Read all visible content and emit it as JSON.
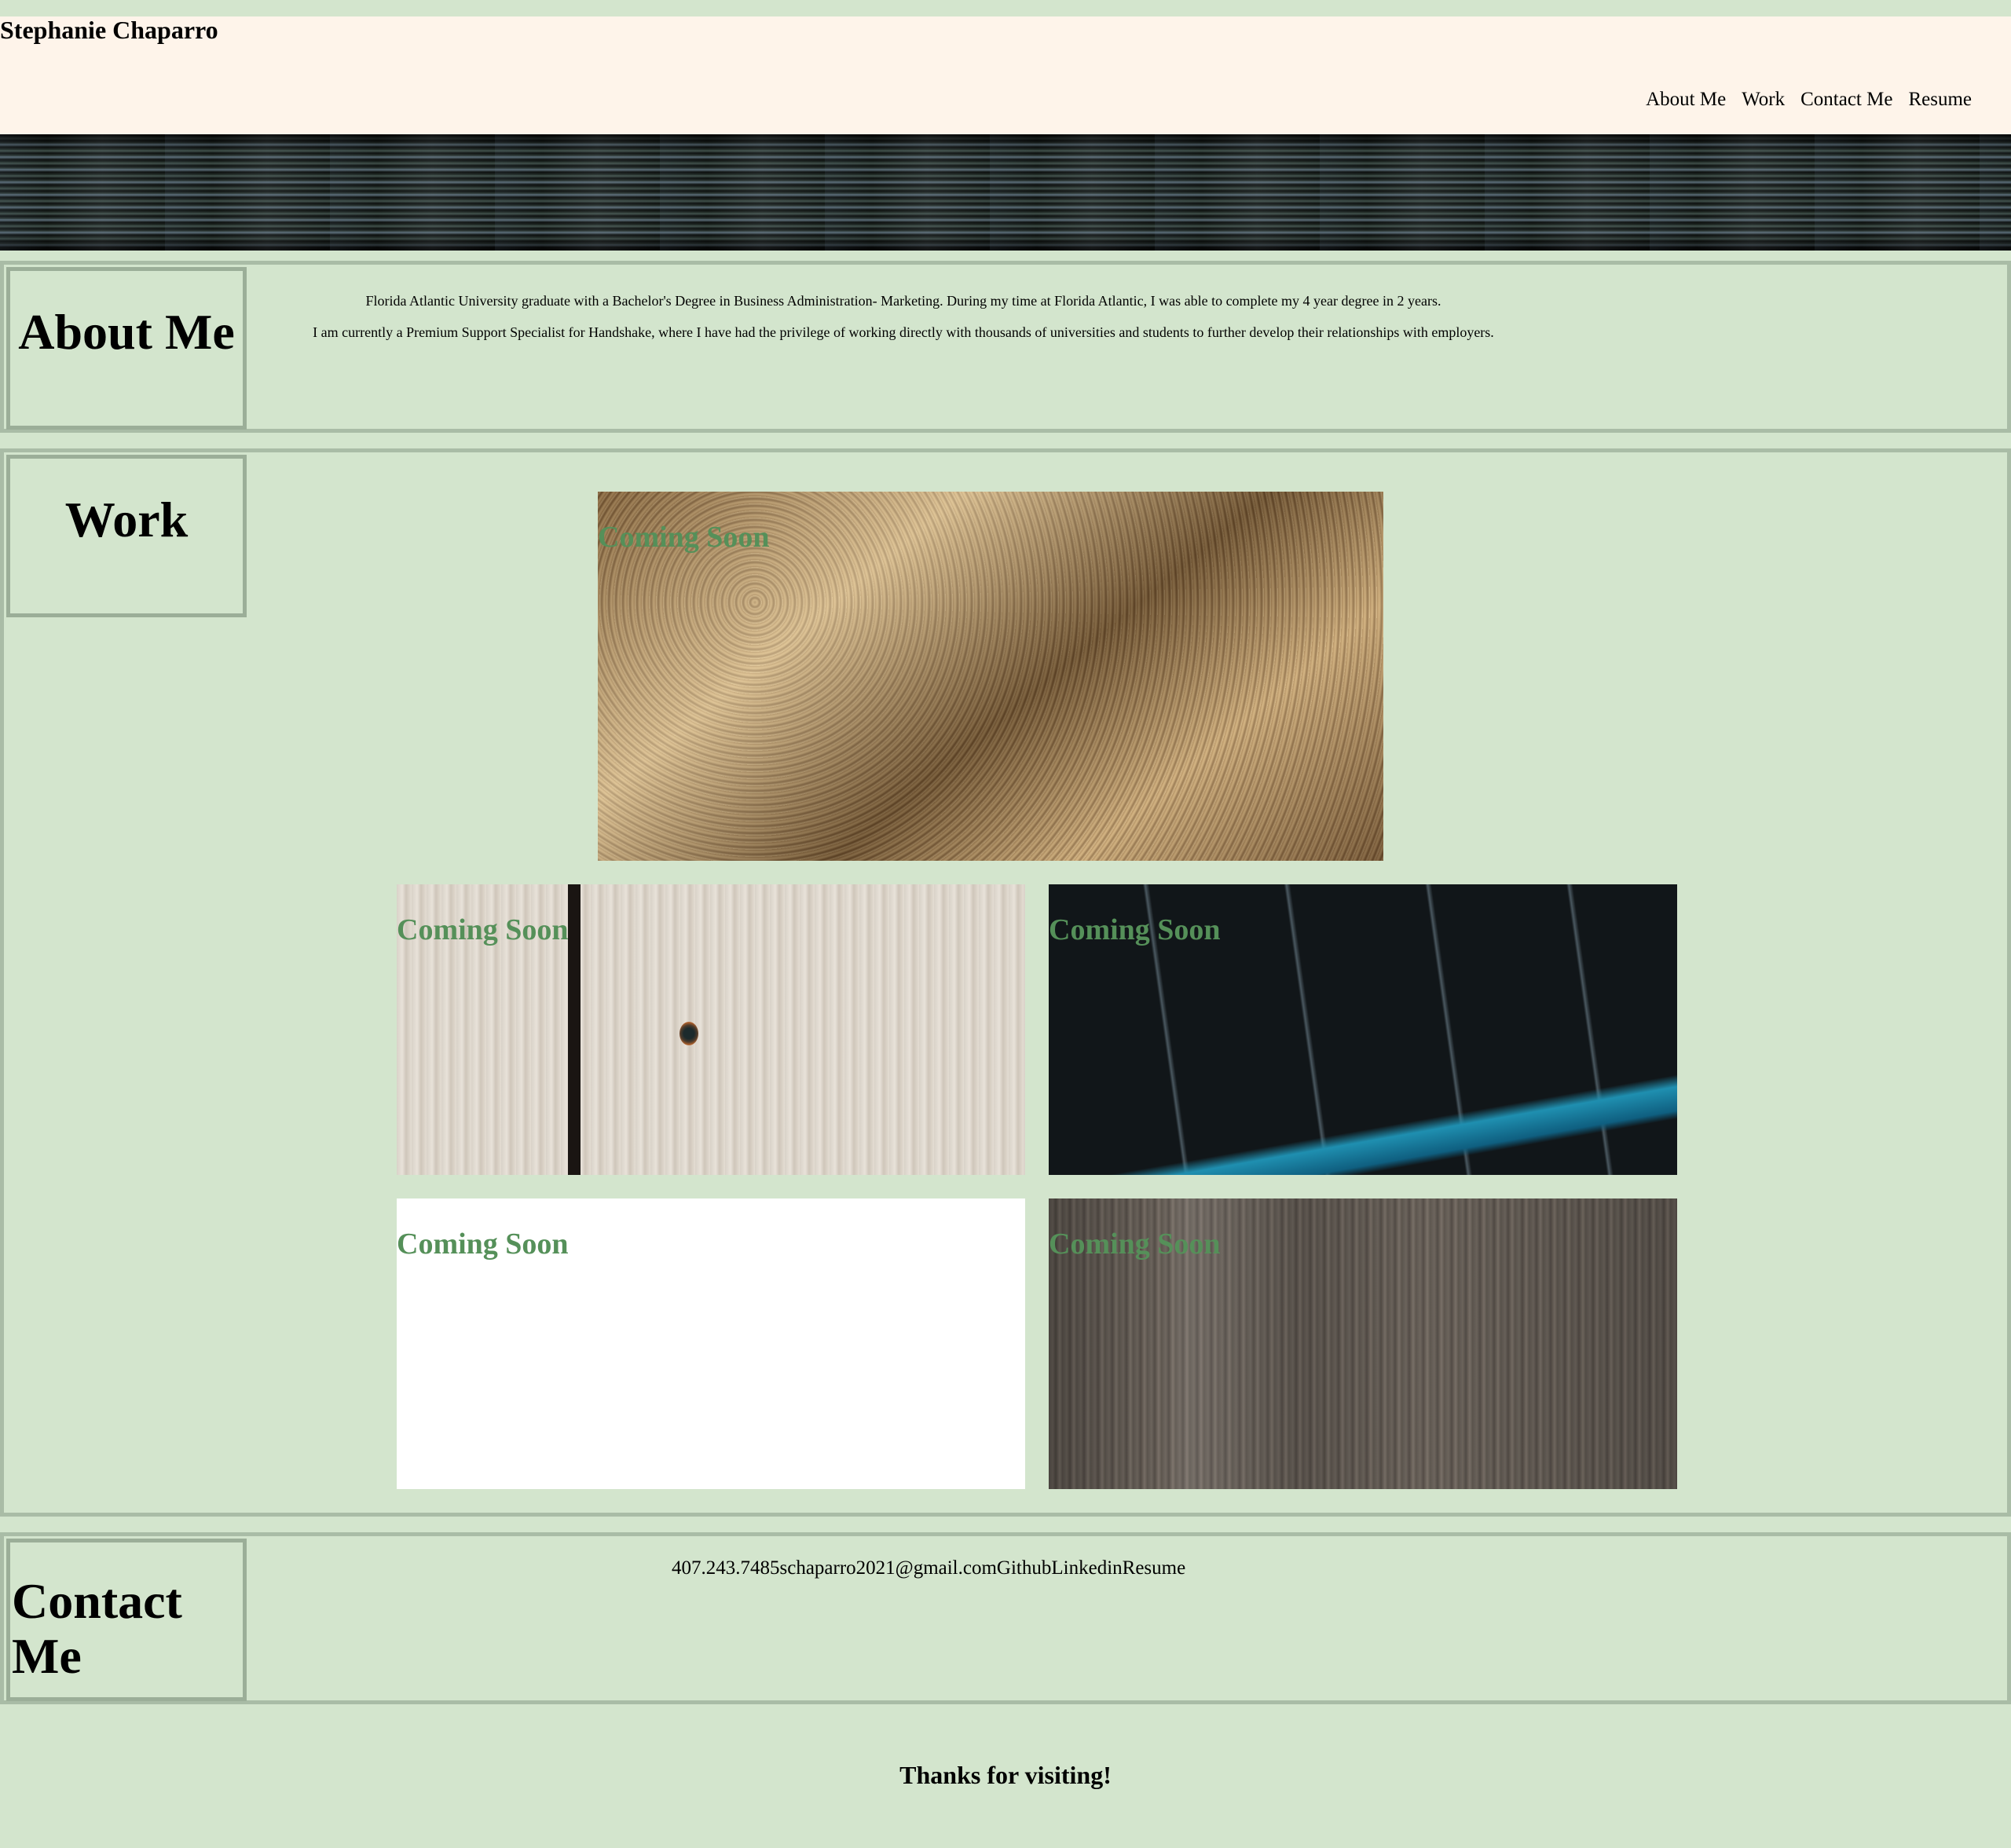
{
  "header": {
    "site_name": "Stephanie Chaparro",
    "nav": [
      "About Me",
      "Work",
      "Contact Me",
      "Resume"
    ]
  },
  "about": {
    "title": "About Me",
    "paragraphs": [
      "Florida Atlantic University graduate with a Bachelor's Degree in Business Administration- Marketing. During my time at Florida Atlantic, I was able to complete my 4 year degree in 2 years.",
      "I am currently a Premium Support Specialist for Handshake, where I have had the privilege of working directly with thousands of universities and students to further develop their relationships with employers."
    ]
  },
  "work": {
    "title": "Work",
    "cards": [
      {
        "label": "Coming Soon"
      },
      {
        "label": "Coming Soon"
      },
      {
        "label": "Coming Soon"
      },
      {
        "label": "Coming Soon"
      },
      {
        "label": "Coming Soon"
      }
    ]
  },
  "contact": {
    "title": "Contact Me",
    "phone": "407.243.7485",
    "email": "schaparro2021@gmail.com",
    "links": [
      "Github",
      "Linkedin",
      "Resume"
    ]
  },
  "footer": {
    "message": "Thanks for visiting!"
  },
  "colors": {
    "page_background": "#d3e5cd",
    "header_background": "#fef4ea",
    "section_border": "#a9bca6",
    "coming_soon_text": "#559059"
  }
}
